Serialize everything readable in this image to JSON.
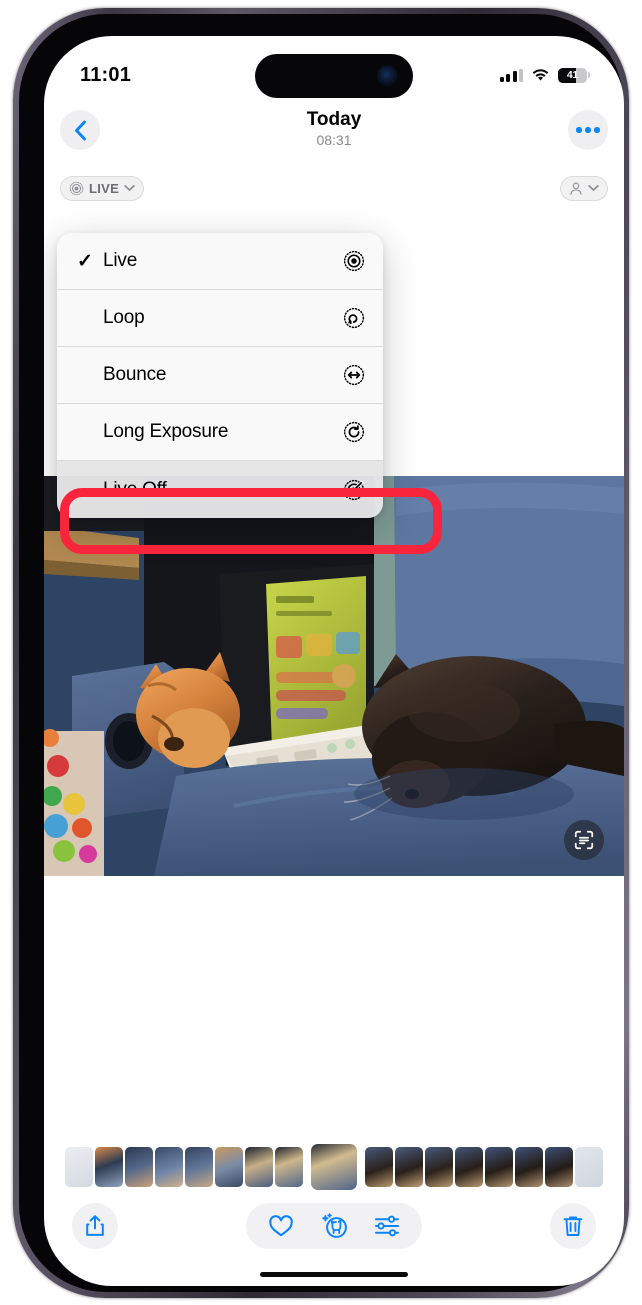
{
  "status_bar": {
    "time": "11:01",
    "signal_icon": "cellular-bars-icon",
    "wifi_icon": "wifi-icon",
    "battery_percent": "41",
    "battery_level": 41
  },
  "nav_bar": {
    "back_icon": "chevron-left-icon",
    "title": "Today",
    "subtitle": "08:31",
    "more_icon": "ellipsis-icon"
  },
  "badges": {
    "live_badge": {
      "label": "LIVE",
      "icon": "live-photo-icon",
      "chevron": "chevron-down-icon"
    },
    "people_badge": {
      "icon": "person-icon",
      "chevron": "chevron-down-icon"
    }
  },
  "live_menu": {
    "items": [
      {
        "label": "Live",
        "icon": "live-photo-icon",
        "checked": true,
        "highlighted": false
      },
      {
        "label": "Loop",
        "icon": "loop-icon",
        "checked": false,
        "highlighted": false
      },
      {
        "label": "Bounce",
        "icon": "bounce-icon",
        "checked": false,
        "highlighted": false
      },
      {
        "label": "Long Exposure",
        "icon": "long-exposure-icon",
        "checked": false,
        "highlighted": false
      },
      {
        "label": "Live Off",
        "icon": "live-photo-off-icon",
        "checked": false,
        "highlighted": true
      }
    ],
    "check_glyph": "✓"
  },
  "annotation": {
    "color": "#f9253c",
    "target": "Live Off"
  },
  "photo": {
    "live_text_icon": "live-text-scan-icon",
    "description": "Two cats on a blue couch with a laptop"
  },
  "toolbar": {
    "share_icon": "share-icon",
    "favorite_icon": "heart-icon",
    "pets_icon": "pet-lookup-icon",
    "adjust_icon": "adjustments-icon",
    "delete_icon": "trash-icon"
  },
  "colors": {
    "accent": "#0a84ff",
    "annotation_red": "#f9253c",
    "toolbar_bg": "#f1f1f3",
    "menu_bg": "#f9f9f9"
  }
}
